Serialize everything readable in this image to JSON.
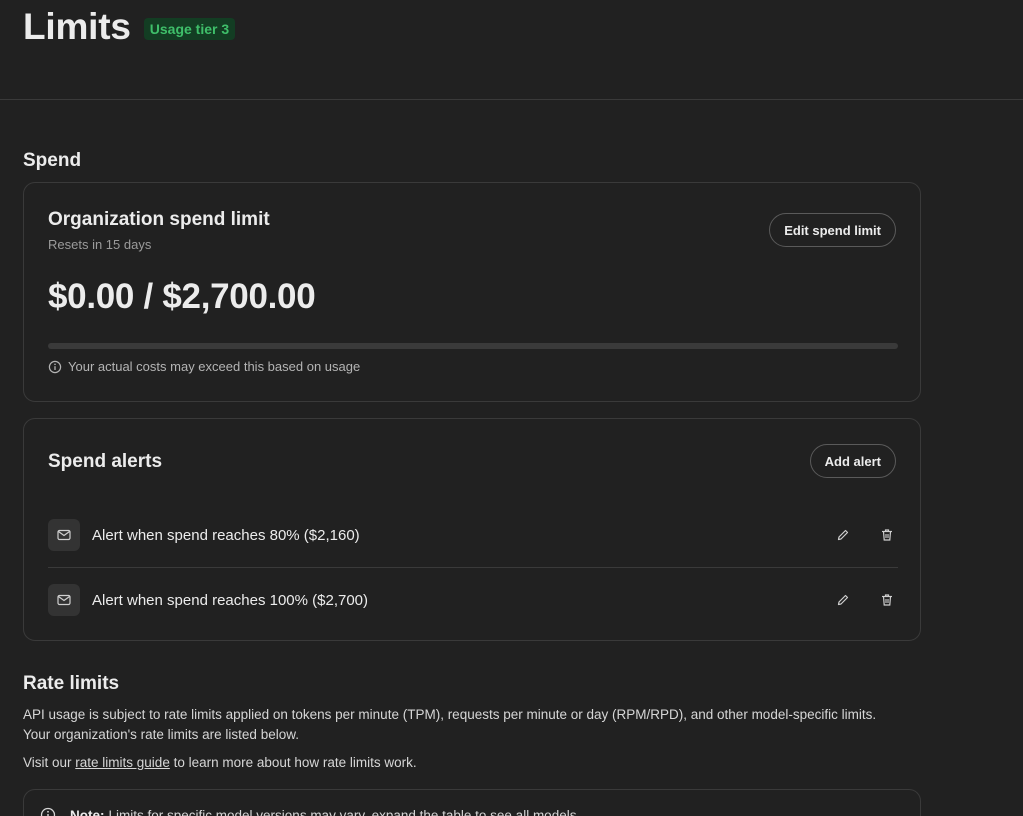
{
  "header": {
    "title": "Limits",
    "tier_badge": "Usage tier 3"
  },
  "spend": {
    "section_title": "Spend",
    "limit_card": {
      "title": "Organization spend limit",
      "subtitle": "Resets in 15 days",
      "edit_button": "Edit spend limit",
      "amount": "$0.00 / $2,700.00",
      "progress_fraction": 0,
      "note": "Your actual costs may exceed this based on usage"
    },
    "alerts_card": {
      "title": "Spend alerts",
      "add_button": "Add alert",
      "alerts": [
        {
          "text": "Alert when spend reaches 80% ($2,160)"
        },
        {
          "text": "Alert when spend reaches 100% ($2,700)"
        }
      ]
    }
  },
  "rate_limits": {
    "section_title": "Rate limits",
    "description_line1": "API usage is subject to rate limits applied on tokens per minute (TPM), requests per minute or day (RPM/RPD), and other model-specific limits.",
    "description_line2": "Your organization's rate limits are listed below.",
    "visit_prefix": "Visit our ",
    "guide_link": "rate limits guide",
    "visit_suffix": " to learn more about how rate limits work.",
    "note_label": "Note:",
    "note_text": "Limits for specific model versions may vary, expand the table to see all models."
  },
  "colors": {
    "background": "#212121",
    "border": "#3a3a3a",
    "badge_bg": "#133d23",
    "badge_text": "#3fbf6a"
  }
}
